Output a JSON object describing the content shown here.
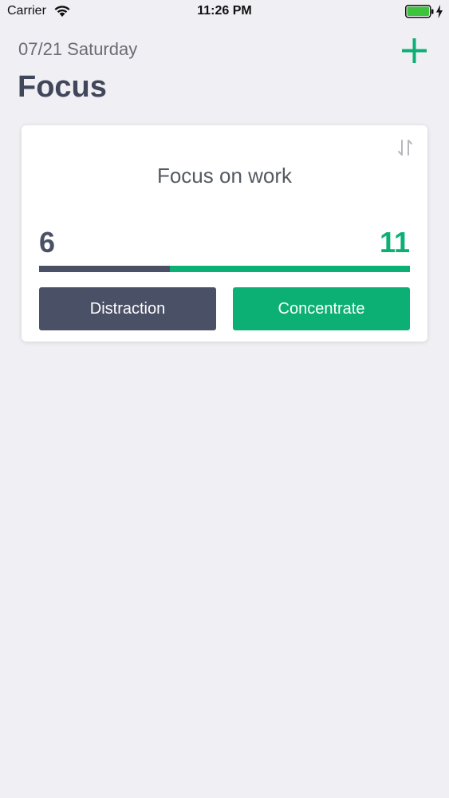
{
  "status_bar": {
    "carrier": "Carrier",
    "time": "11:26 PM",
    "battery_color": "#3cc43c"
  },
  "header": {
    "date": "07/21 Saturday",
    "title": "Focus",
    "add_icon": "plus-icon",
    "accent_color": "#0cb074"
  },
  "card": {
    "title": "Focus on work",
    "sort_icon": "swap-vertical-icon",
    "distraction_count": "6",
    "concentrate_count": "11",
    "distraction_fraction": 0.353,
    "distraction_label": "Distraction",
    "concentrate_label": "Concentrate",
    "distraction_color": "#4a5066",
    "concentrate_color": "#0cb074"
  }
}
